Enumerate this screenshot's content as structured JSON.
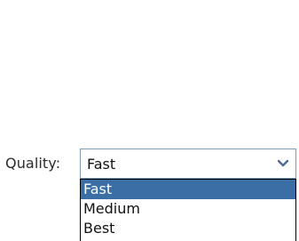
{
  "form": {
    "quality_label": "Quality:",
    "quality_select": {
      "value": "Fast",
      "arrow_icon": "chevron-down-icon",
      "options": [
        "Fast",
        "Medium",
        "Best"
      ],
      "highlighted_index": 0
    }
  },
  "colors": {
    "highlight": "#3a6ea5",
    "border": "#7f9db9",
    "text": "#111111",
    "arrow": "#4d6a99"
  }
}
